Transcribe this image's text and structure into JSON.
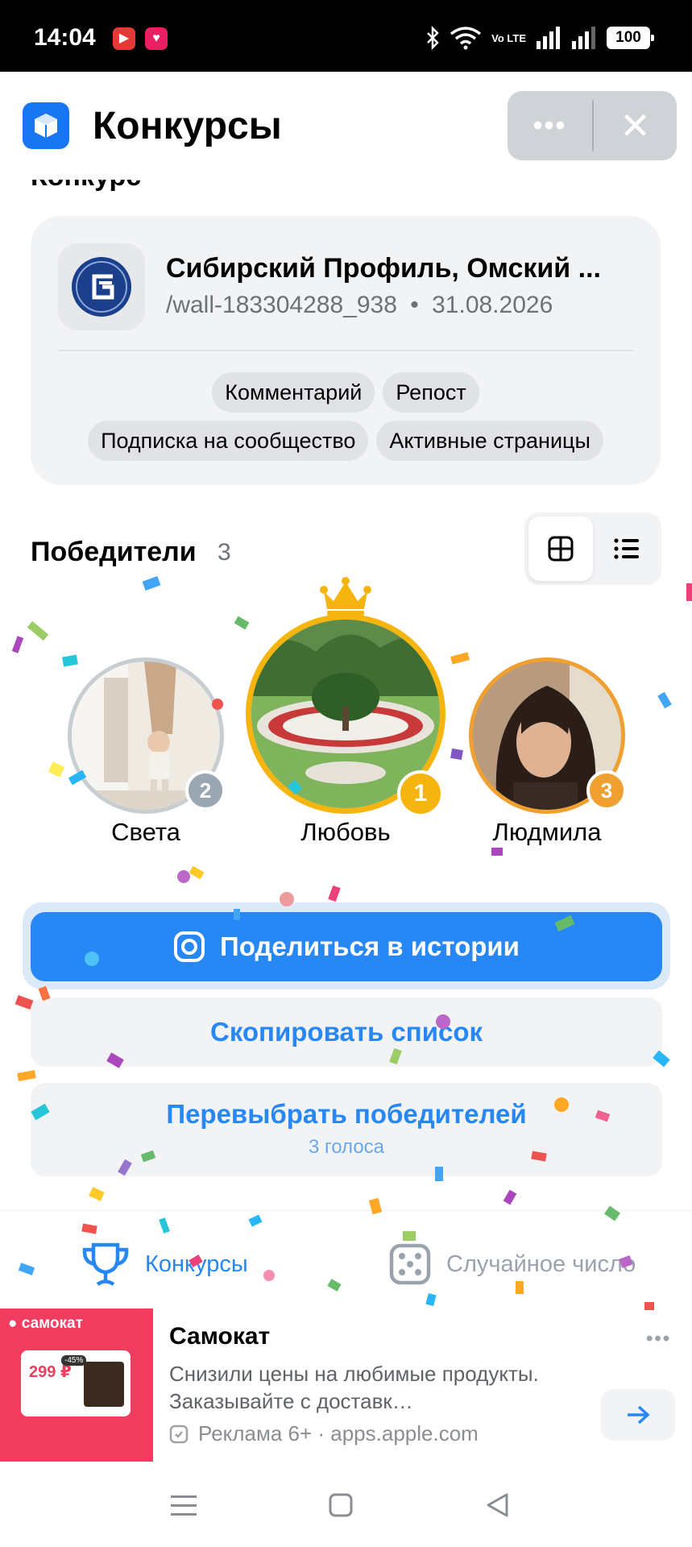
{
  "status_bar": {
    "time": "14:04",
    "network": "Vo LTE",
    "battery": "100"
  },
  "header": {
    "title": "Конкурсы",
    "menu_icon": "more-horizontal-icon",
    "close_icon": "close-icon"
  },
  "section": {
    "clipped_title": "Конкурс"
  },
  "contest": {
    "group_name": "Сибирский Профиль, Омский ...",
    "post_path": "/wall-183304288_938",
    "separator": "•",
    "date": "31.08.2026",
    "conditions": [
      "Комментарий",
      "Репост",
      "Подписка на сообщество",
      "Активные страницы"
    ]
  },
  "winners": {
    "title": "Победители",
    "count": "3",
    "list": [
      {
        "name": "Света",
        "rank": "2"
      },
      {
        "name": "Любовь",
        "rank": "1"
      },
      {
        "name": "Людмила",
        "rank": "3"
      }
    ]
  },
  "actions": {
    "share": "Поделиться в истории",
    "copy": "Скопировать список",
    "reroll": "Перевыбрать победителей",
    "reroll_sub": "3 голоса"
  },
  "tabs": [
    {
      "label": "Конкурсы",
      "icon": "trophy-icon",
      "active": true
    },
    {
      "label": "Случайное число",
      "icon": "dice-icon",
      "active": false
    }
  ],
  "ad": {
    "brand_badge": "самокат",
    "price": "299 ₽",
    "discount": "-45%",
    "title": "Самокат",
    "text": "Снизили цены на любимые продукты. Заказывайте с доставк…",
    "source": "Реклама 6+ · apps.apple.com"
  },
  "colors": {
    "accent": "#2787f5",
    "gold": "#f5b50e",
    "silver": "#9aa6b2",
    "bronze": "#f0a030",
    "ad_red": "#f03d5f"
  }
}
